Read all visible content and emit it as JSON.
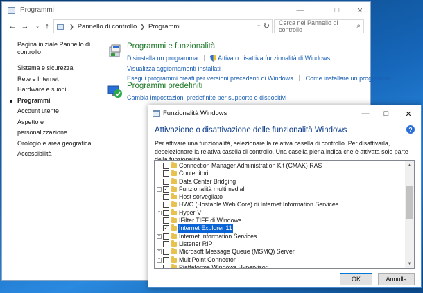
{
  "control_panel": {
    "title": "Programmi",
    "breadcrumb": [
      "Pannello di controllo",
      "Programmi"
    ],
    "search_placeholder": "Cerca nel Pannello di controllo",
    "sidebar": {
      "home": "Pagina iniziale Pannello di controllo",
      "items": [
        "Sistema e sicurezza",
        "Rete e Internet",
        "Hardware e suoni",
        "Programmi",
        "Account utente",
        "Aspetto e personalizzazione",
        "Orologio e area geografica",
        "Accessibilità"
      ],
      "current": "Programmi"
    },
    "programs_features": {
      "heading": "Programmi e funzionalità",
      "link_uninstall": "Disinstalla un programma",
      "link_toggle_features": "Attiva o disattiva funzionalità di Windows",
      "link_updates": "Visualizza aggiornamenti installati",
      "link_older_programs": "Esegui programmi creati per versioni precedenti di Windows",
      "link_how_to_install": "Come installare un programma"
    },
    "default_programs": {
      "heading": "Programmi predefiniti",
      "link_change_defaults": "Cambia impostazioni predefinite per supporto o dispositivi"
    }
  },
  "features_dialog": {
    "title": "Funzionalità Windows",
    "heading": "Attivazione o disattivazione delle funzionalità Windows",
    "description": "Per attivare una funzionalità, selezionare la relativa casella di controllo. Per disattivarla, deselezionare la relativa casella di controllo. Una casella piena indica che è attivata solo parte della funzionalità.",
    "features": [
      {
        "label": "Connection Manager Administration Kit (CMAK) RAS",
        "expandable": false,
        "state": "unchecked"
      },
      {
        "label": "Contenitori",
        "expandable": false,
        "state": "unchecked"
      },
      {
        "label": "Data Center Bridging",
        "expandable": false,
        "state": "unchecked"
      },
      {
        "label": "Funzionalità multimediali",
        "expandable": true,
        "state": "checked"
      },
      {
        "label": "Host sorvegliato",
        "expandable": false,
        "state": "unchecked"
      },
      {
        "label": "HWC (Hostable Web Core) di Internet Information Services",
        "expandable": false,
        "state": "unchecked"
      },
      {
        "label": "Hyper-V",
        "expandable": true,
        "state": "unchecked"
      },
      {
        "label": "IFilter TIFF di Windows",
        "expandable": false,
        "state": "unchecked"
      },
      {
        "label": "Internet Explorer 11",
        "expandable": false,
        "state": "checked",
        "selected": true
      },
      {
        "label": "Internet Information Services",
        "expandable": true,
        "state": "unchecked"
      },
      {
        "label": "Listener RIP",
        "expandable": false,
        "state": "unchecked"
      },
      {
        "label": "Microsoft Message Queue (MSMQ) Server",
        "expandable": true,
        "state": "unchecked"
      },
      {
        "label": "MultiPoint Connector",
        "expandable": true,
        "state": "unchecked"
      },
      {
        "label": "Piattaforma Windows Hypervisor",
        "expandable": false,
        "state": "unchecked"
      }
    ],
    "ok_label": "OK",
    "cancel_label": "Annulla"
  },
  "colors": {
    "heading_green": "#1f7a29",
    "link_blue": "#1a5fb4",
    "dialog_heading": "#0a3a8a",
    "selection": "#0a64d6"
  }
}
